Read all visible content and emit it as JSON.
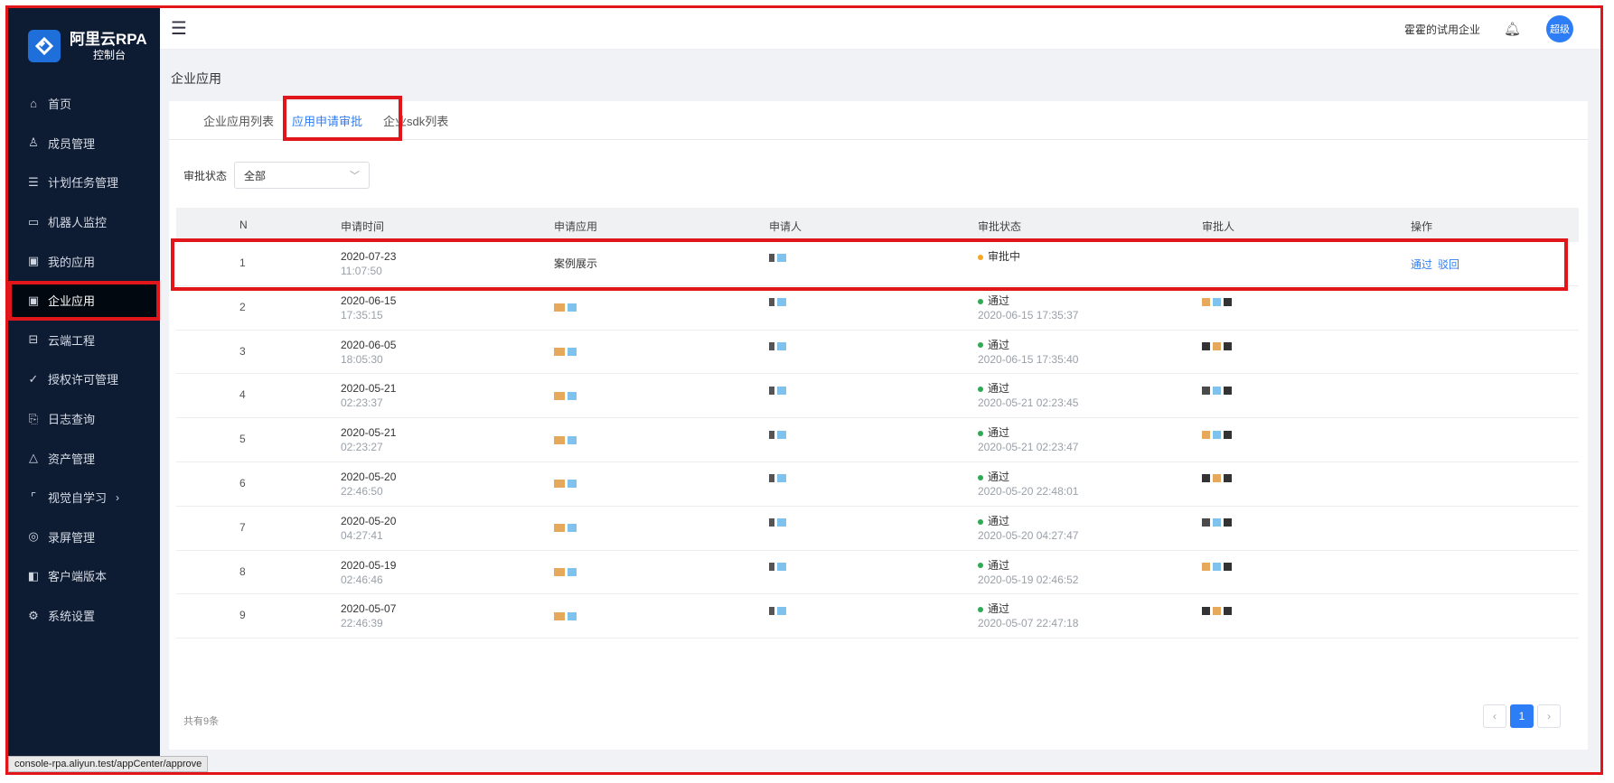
{
  "brand": {
    "title": "阿里云RPA",
    "subtitle": "控制台"
  },
  "sidebar": {
    "items": [
      {
        "label": "首页",
        "icon": "home-icon",
        "glyph": "⌂"
      },
      {
        "label": "成员管理",
        "icon": "users-icon",
        "glyph": "♙"
      },
      {
        "label": "计划任务管理",
        "icon": "list-icon",
        "glyph": "☰"
      },
      {
        "label": "机器人监控",
        "icon": "monitor-icon",
        "glyph": "▭"
      },
      {
        "label": "我的应用",
        "icon": "app-icon",
        "glyph": "▣"
      },
      {
        "label": "企业应用",
        "icon": "enterprise-app-icon",
        "glyph": "▣",
        "active": true
      },
      {
        "label": "云端工程",
        "icon": "cloud-project-icon",
        "glyph": "⊟"
      },
      {
        "label": "授权许可管理",
        "icon": "license-icon",
        "glyph": "✓"
      },
      {
        "label": "日志查询",
        "icon": "log-icon",
        "glyph": "⎘"
      },
      {
        "label": "资产管理",
        "icon": "asset-icon",
        "glyph": "△"
      },
      {
        "label": "视觉自学习",
        "icon": "vision-icon",
        "glyph": "⌜",
        "expand": "›"
      },
      {
        "label": "录屏管理",
        "icon": "record-icon",
        "glyph": "◎"
      },
      {
        "label": "客户端版本",
        "icon": "client-icon",
        "glyph": "◧"
      },
      {
        "label": "系统设置",
        "icon": "settings-icon",
        "glyph": "⚙"
      }
    ]
  },
  "statusbar": {
    "url": "console-rpa.aliyun.test/appCenter/approve"
  },
  "header": {
    "company": "霍霍的试用企业",
    "avatar_text": "超级"
  },
  "breadcrumb": {
    "title": "企业应用"
  },
  "tabs": {
    "list": "企业应用列表",
    "approve": "应用申请审批",
    "sdk": "企业sdk列表"
  },
  "filter": {
    "label": "审批状态",
    "value": "全部"
  },
  "table": {
    "headers": {
      "n": "N",
      "time": "申请时间",
      "app": "申请应用",
      "applicant": "申请人",
      "status": "审批状态",
      "approver": "审批人",
      "op": "操作"
    },
    "rows": [
      {
        "n": "1",
        "date": "2020-07-23",
        "time": "11:07:50",
        "app": "案例展示",
        "status": "审批中",
        "status_color": "#f5a623",
        "status_time": "",
        "ops": [
          "通过",
          "驳回"
        ]
      },
      {
        "n": "2",
        "date": "2020-06-15",
        "time": "17:35:15",
        "app": "",
        "status": "通过",
        "status_color": "#2eaa55",
        "status_time": "2020-06-15 17:35:37",
        "ops": []
      },
      {
        "n": "3",
        "date": "2020-06-05",
        "time": "18:05:30",
        "app": "",
        "status": "通过",
        "status_color": "#2eaa55",
        "status_time": "2020-06-15 17:35:40",
        "ops": []
      },
      {
        "n": "4",
        "date": "2020-05-21",
        "time": "02:23:37",
        "app": "",
        "status": "通过",
        "status_color": "#2eaa55",
        "status_time": "2020-05-21 02:23:45",
        "ops": []
      },
      {
        "n": "5",
        "date": "2020-05-21",
        "time": "02:23:27",
        "app": "",
        "status": "通过",
        "status_color": "#2eaa55",
        "status_time": "2020-05-21 02:23:47",
        "ops": []
      },
      {
        "n": "6",
        "date": "2020-05-20",
        "time": "22:46:50",
        "app": "",
        "status": "通过",
        "status_color": "#2eaa55",
        "status_time": "2020-05-20 22:48:01",
        "ops": []
      },
      {
        "n": "7",
        "date": "2020-05-20",
        "time": "04:27:41",
        "app": "",
        "status": "通过",
        "status_color": "#2eaa55",
        "status_time": "2020-05-20 04:27:47",
        "ops": []
      },
      {
        "n": "8",
        "date": "2020-05-19",
        "time": "02:46:46",
        "app": "",
        "status": "通过",
        "status_color": "#2eaa55",
        "status_time": "2020-05-19 02:46:52",
        "ops": []
      },
      {
        "n": "9",
        "date": "2020-05-07",
        "time": "22:46:39",
        "app": "",
        "status": "通过",
        "status_color": "#2eaa55",
        "status_time": "2020-05-07 22:47:18",
        "ops": []
      }
    ]
  },
  "footer": {
    "total": "共有9条",
    "page": "1",
    "prev": "‹",
    "next": "›"
  },
  "colors": {
    "primary": "#2d7df7",
    "highlight": "#e0161b",
    "sidebar": "#0d1b33"
  }
}
